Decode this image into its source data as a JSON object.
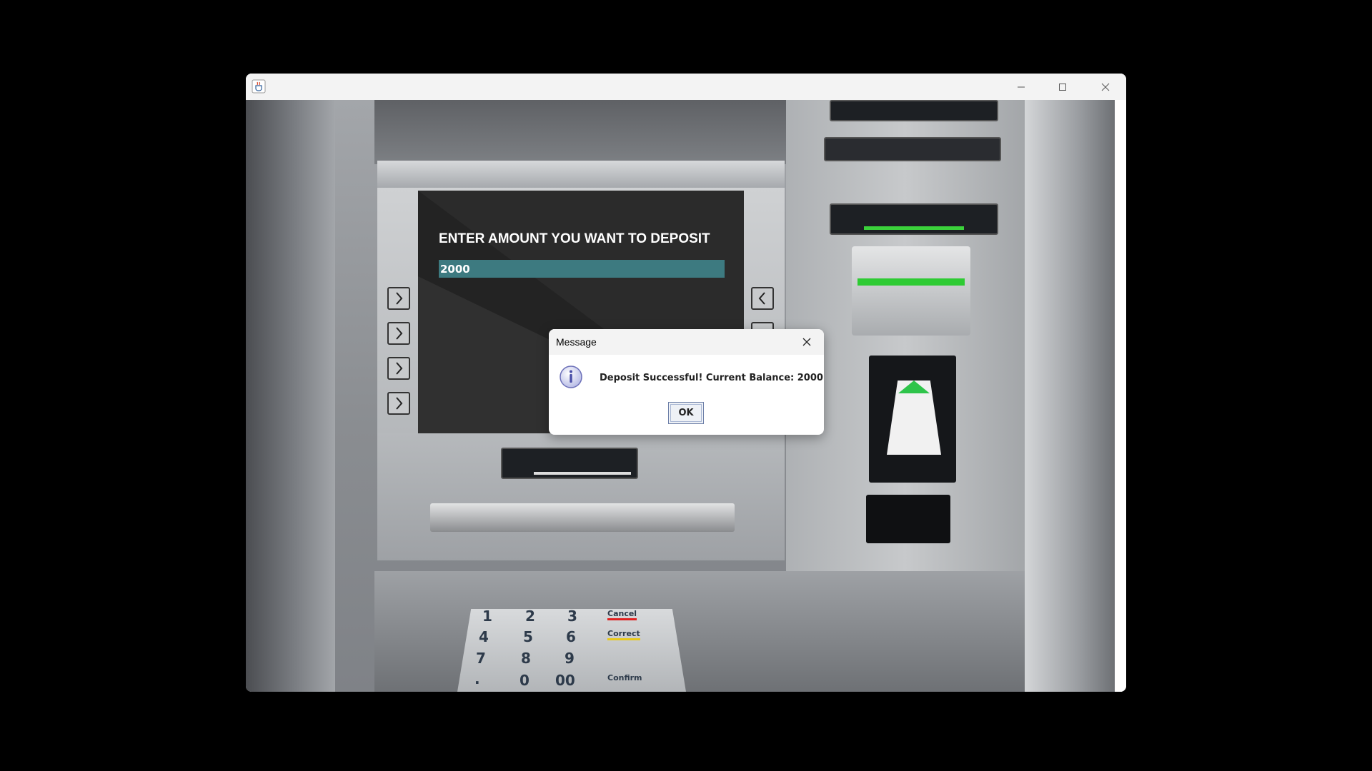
{
  "window": {
    "app_icon": "java-coffee-cup-icon",
    "controls": {
      "minimize_icon": "minimize-icon",
      "maximize_icon": "maximize-icon",
      "close_icon": "close-icon"
    }
  },
  "atm_screen": {
    "prompt": "ENTER AMOUNT YOU WANT TO DEPOSIT",
    "amount_value": "2000",
    "amount_field_color": "#3d7a80"
  },
  "keypad": {
    "digits": [
      "1",
      "2",
      "3",
      "4",
      "5",
      "6",
      "7",
      "8",
      "9",
      ".",
      "0",
      "00"
    ],
    "function_keys": [
      "Cancel",
      "Correct",
      "Confirm"
    ]
  },
  "dialog": {
    "title": "Message",
    "icon": "information-icon",
    "message": "Deposit Successful! Current Balance: 2000",
    "ok_label": "OK"
  }
}
